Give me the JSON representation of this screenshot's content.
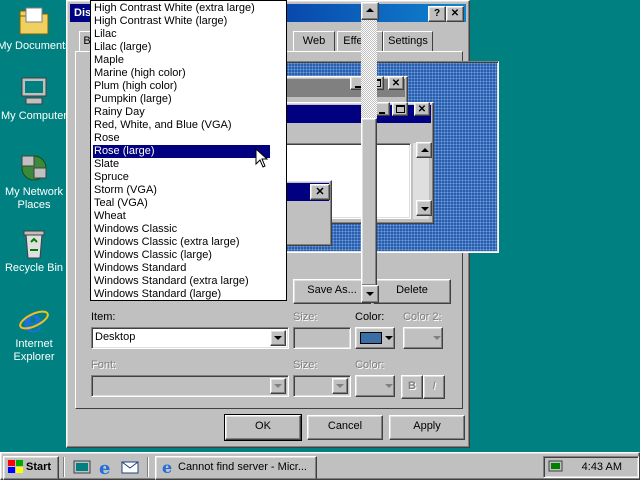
{
  "desktop": {
    "icons": [
      {
        "label": "My Documents",
        "icon": "my-documents-icon"
      },
      {
        "label": "My Computer",
        "icon": "my-computer-icon"
      },
      {
        "label": "My Network Places",
        "icon": "network-places-icon"
      },
      {
        "label": "Recycle Bin",
        "icon": "recycle-bin-icon"
      },
      {
        "label": "Internet Explorer",
        "icon": "internet-explorer-icon"
      }
    ]
  },
  "dialog": {
    "title": "Dis",
    "tabs": [
      "B",
      "Web",
      "Effects",
      "Settings"
    ],
    "help_btn": "?",
    "close_btn": "✕",
    "scheme": {
      "options": [
        "High Contrast White (extra large)",
        "High Contrast White (large)",
        "Lilac",
        "Lilac (large)",
        "Maple",
        "Marine (high color)",
        "Plum (high color)",
        "Pumpkin (large)",
        "Rainy Day",
        "Red, White, and Blue (VGA)",
        "Rose",
        "Rose (large)",
        "Slate",
        "Spruce",
        "Storm (VGA)",
        "Teal (VGA)",
        "Wheat",
        "Windows Classic",
        "Windows Classic (extra large)",
        "Windows Classic (large)",
        "Windows Standard",
        "Windows Standard (extra large)",
        "Windows Standard (large)"
      ],
      "selected": "Rose (large)",
      "save_as": "Save As...",
      "delete": "Delete"
    },
    "item_label": "Item:",
    "item_value": "Desktop",
    "size_label": "Size:",
    "color_label": "Color:",
    "color2_label": "Color 2:",
    "font_label": "Font:",
    "size2_label": "Size:",
    "color3_label": "Color:",
    "bold": "B",
    "italic": "I",
    "desktop_color": "#3a6ea5",
    "ok": "OK",
    "cancel": "Cancel",
    "apply": "Apply"
  },
  "taskbar": {
    "start": "Start",
    "task": "Cannot find server - Micr...",
    "clock": "4:43 AM"
  },
  "colors": {
    "desktop": "#008080",
    "selection": "#000080",
    "face": "#c0c0c0"
  }
}
